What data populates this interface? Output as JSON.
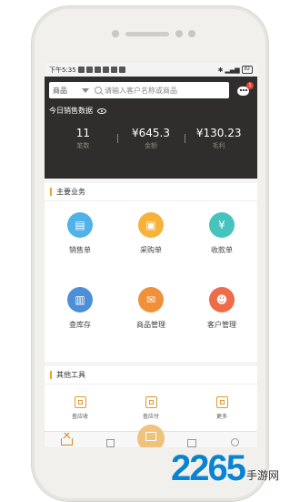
{
  "status_bar": {
    "time": "下午5:35",
    "battery": "82"
  },
  "search": {
    "category": "商品",
    "placeholder": "请输入客户名称或商品"
  },
  "notifications": {
    "badge": "1"
  },
  "today": {
    "title": "今日销售数据",
    "stats": [
      {
        "value": "11",
        "label": "笔数"
      },
      {
        "value": "¥645.3",
        "label": "金额"
      },
      {
        "value": "¥130.23",
        "label": "毛利"
      }
    ]
  },
  "main_business": {
    "title": "主要业务",
    "items": [
      {
        "label": "销售单",
        "icon": "sales-order-icon",
        "color": "#4fb2e8"
      },
      {
        "label": "采购单",
        "icon": "purchase-order-icon",
        "color": "#f7b23b"
      },
      {
        "label": "收款单",
        "icon": "receipt-icon",
        "color": "#46c3bd"
      },
      {
        "label": "查库存",
        "icon": "inventory-icon",
        "color": "#4d8fd6"
      },
      {
        "label": "商品管理",
        "icon": "product-manage-icon",
        "color": "#f0913a"
      },
      {
        "label": "客户管理",
        "icon": "customer-manage-icon",
        "color": "#ee6c49"
      }
    ]
  },
  "other_tools": {
    "title": "其他工具",
    "items": [
      {
        "label": "查应收",
        "icon": "receivable-icon"
      },
      {
        "label": "查应付",
        "icon": "payable-icon"
      },
      {
        "label": "更多",
        "icon": "more-icon"
      }
    ]
  },
  "watermark": {
    "number": "2265",
    "text": "手游网"
  },
  "colors": {
    "header_bg": "#2f2e2c",
    "accent": "#f0a02b",
    "badge": "#e8432f"
  }
}
